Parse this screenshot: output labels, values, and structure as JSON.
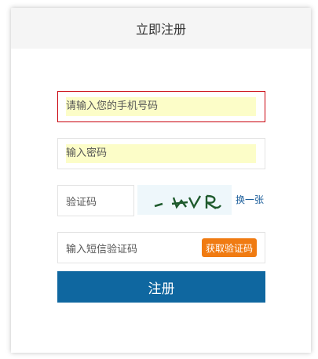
{
  "header": {
    "title": "立即注册"
  },
  "form": {
    "phone_placeholder": "请输入您的手机号码",
    "password_placeholder": "输入密码",
    "captcha_placeholder": "验证码",
    "captcha_refresh_label": "换一张",
    "sms_placeholder": "输入短信验证码",
    "sms_button_label": "获取验证码",
    "submit_label": "注册"
  },
  "colors": {
    "error_border": "#c9000b",
    "autofill_bg": "#fcfdc8",
    "primary_button": "#0f67a0",
    "sms_button": "#f07b12",
    "link": "#1a5d9a"
  }
}
